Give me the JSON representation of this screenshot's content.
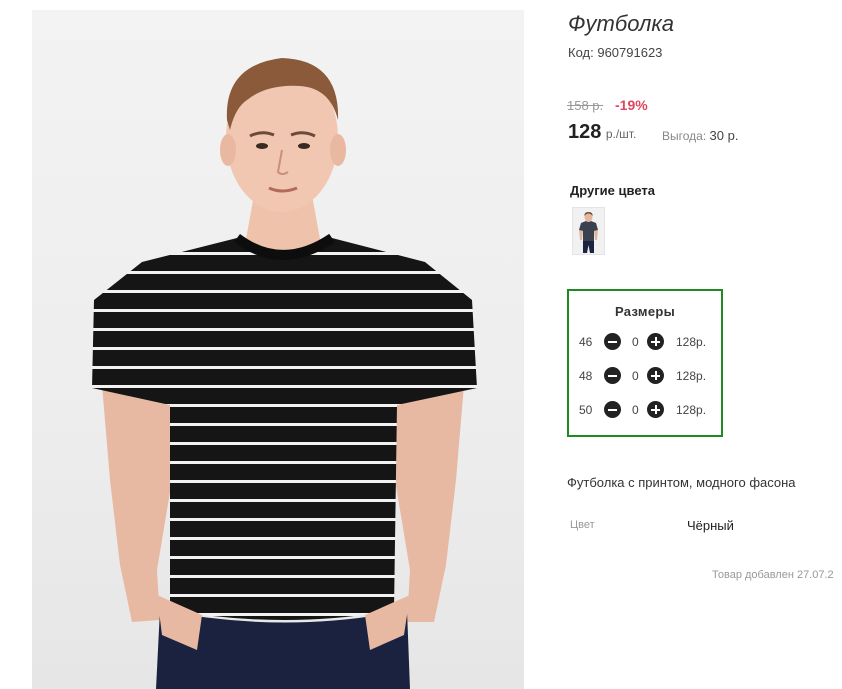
{
  "product": {
    "title": "Футболка",
    "code_label": "Код:",
    "code_value": "960791623",
    "old_price": "158 р.",
    "discount": "-19%",
    "price": "128",
    "price_unit": "р./шт.",
    "saving_label": "Выгода:",
    "saving_value": "30 р."
  },
  "other_colors": {
    "title": "Другие цвета",
    "thumbnail_icon": "dark-tshirt-thumbnail"
  },
  "sizes": {
    "title": "Размеры",
    "rows": [
      {
        "size": "46",
        "qty": "0",
        "price": "128р."
      },
      {
        "size": "48",
        "qty": "0",
        "price": "128р."
      },
      {
        "size": "50",
        "qty": "0",
        "price": "128р."
      }
    ],
    "border_color": "#1f8a1f"
  },
  "description": "Футболка с принтом, модного фасона",
  "attributes": {
    "color_label": "Цвет",
    "color_value": "Чёрный"
  },
  "added_text": "Товар добавлен 27.07.2",
  "colors": {
    "discount": "#e0455f",
    "accent_border": "#1f8a1f"
  }
}
